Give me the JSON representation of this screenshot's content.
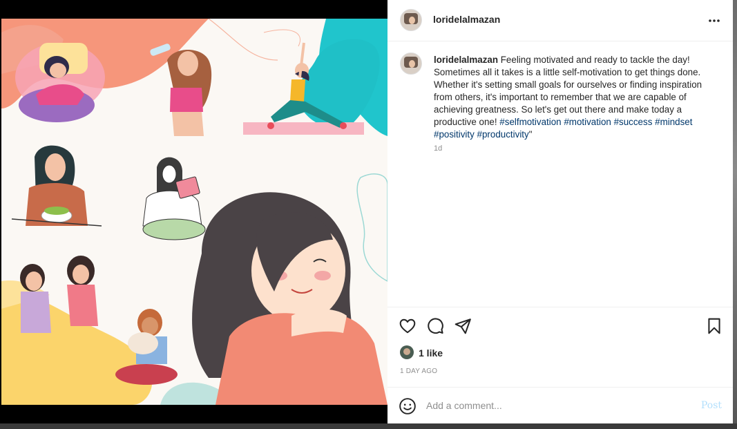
{
  "post": {
    "username": "loridelalmazan",
    "more_icon": "more-horizontal-icon",
    "caption": {
      "username": "loridelalmazan",
      "text": " Feeling motivated and ready to tackle the day! Sometimes all it takes is a little self-motivation to get things done. Whether it's setting small goals for ourselves or finding inspiration from others, it's important to remember that we are capable of achieving greatness. So let's get out there and make today a productive one! ",
      "hashtags": [
        "#selfmotivation",
        "#motivation",
        "#success",
        "#mindset",
        "#positivity",
        "#productivity"
      ],
      "closing": "\""
    },
    "caption_time": "1d",
    "actions": {
      "like_icon": "heart-icon",
      "comment_icon": "comment-bubble-icon",
      "share_icon": "paper-plane-icon",
      "save_icon": "bookmark-icon"
    },
    "likes": "1 like",
    "date": "1 DAY AGO",
    "comment": {
      "emoji_icon": "emoji-smile-icon",
      "placeholder": "Add a comment...",
      "post_label": "Post"
    }
  },
  "colors": {
    "hashtag": "#00376b",
    "post_disabled": "#b2dffc",
    "secondary_text": "#8e8e8e"
  }
}
